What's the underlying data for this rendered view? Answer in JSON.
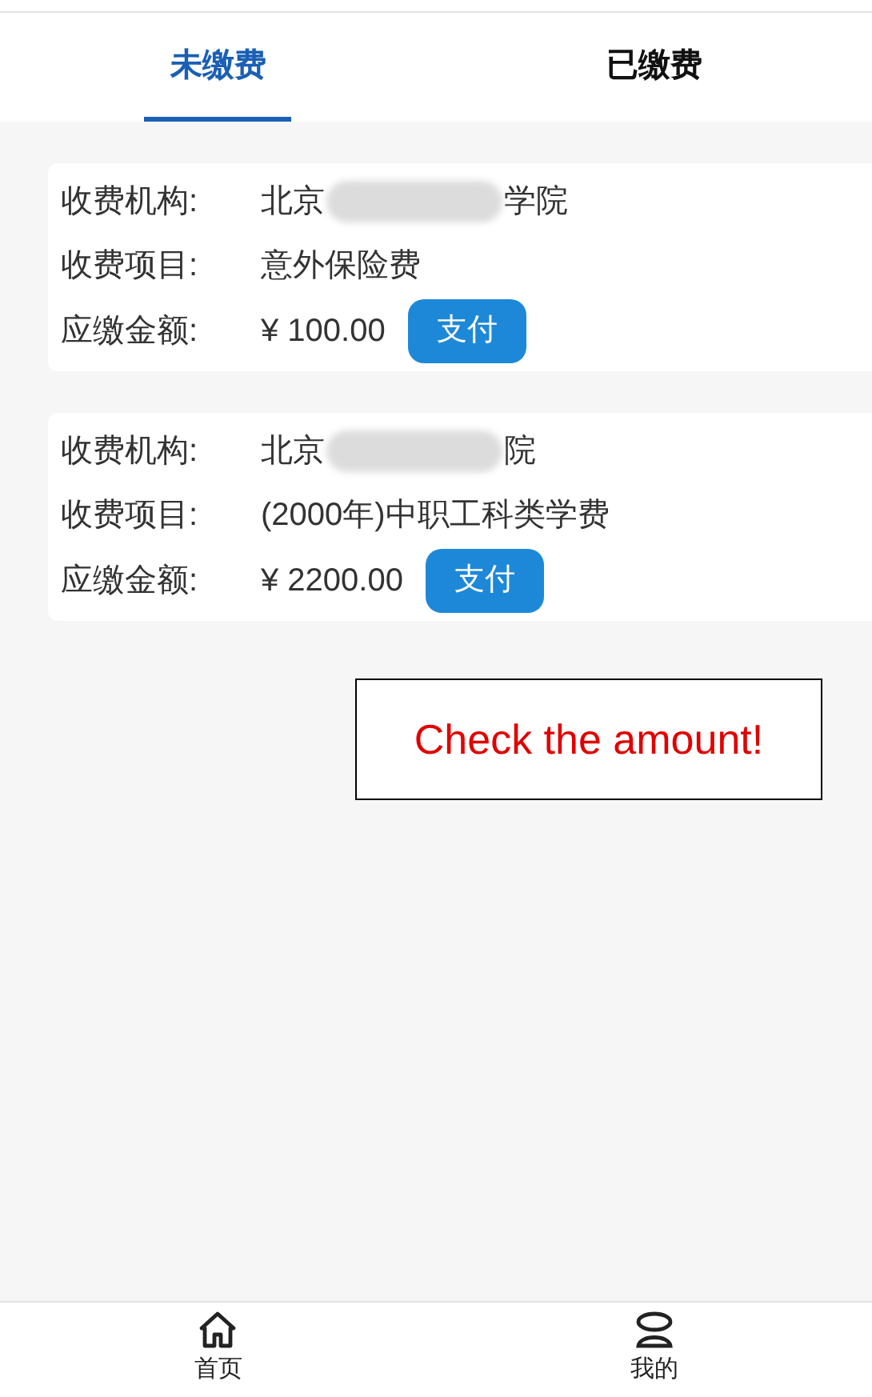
{
  "tabs": [
    {
      "label": "未缴费",
      "selected": true
    },
    {
      "label": "已缴费",
      "selected": false
    }
  ],
  "bills": [
    {
      "institution_label": "收费机构:",
      "institution_start": "北京",
      "institution_end": "学院",
      "item_label": "收费项目:",
      "item": "意外保险费",
      "amount_label": "应缴金额:",
      "amount": "¥ 100.00",
      "pay_button": "支付"
    },
    {
      "institution_label": "收费机构:",
      "institution_start": "北京",
      "institution_end": "院",
      "item_label": "收费项目:",
      "item": "(2000年)中职工科类学费",
      "amount_label": "应缴金额:",
      "amount": "¥ 2200.00",
      "pay_button": "支付"
    }
  ],
  "annotation": "Check the amount!",
  "bottom_nav": [
    {
      "kind": "home",
      "label": "首页"
    },
    {
      "kind": "profile",
      "label": "我的"
    }
  ]
}
